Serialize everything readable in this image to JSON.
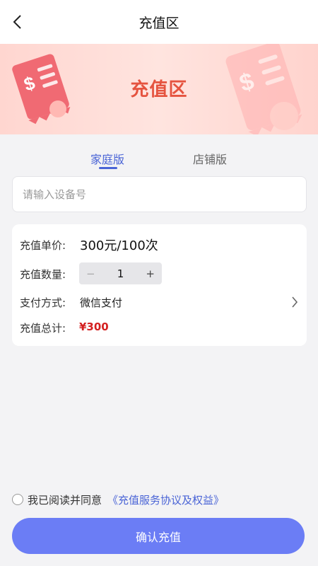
{
  "header": {
    "title": "充值区",
    "back_icon": "chevron-left-icon"
  },
  "banner": {
    "title": "充值区"
  },
  "tabs": [
    {
      "label": "家庭版",
      "active": true
    },
    {
      "label": "店铺版",
      "active": false
    }
  ],
  "device_input": {
    "placeholder": "请输入设备号",
    "value": ""
  },
  "order": {
    "unit_price_label": "充值单价:",
    "unit_price_value": "300元/100次",
    "quantity_label": "充值数量:",
    "quantity_minus": "−",
    "quantity_value": "1",
    "quantity_plus": "+",
    "payment_label": "支付方式:",
    "payment_value": "微信支付",
    "total_label": "充值总计:",
    "total_value": "¥300"
  },
  "agreement": {
    "text": "我已阅读并同意",
    "link": "《充值服务协议及权益》",
    "checked": false
  },
  "confirm_button": "确认充值",
  "colors": {
    "accent": "#4a64d6",
    "button": "#6b7df5",
    "total": "#d42020",
    "banner_title": "#e5533f"
  }
}
